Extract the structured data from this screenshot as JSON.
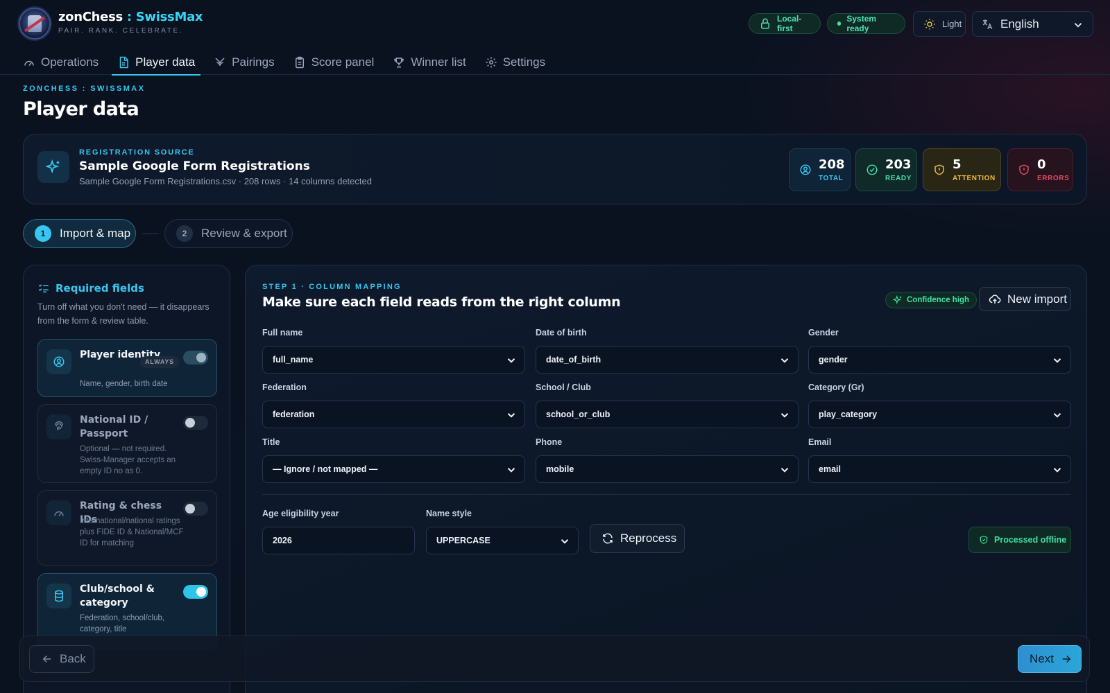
{
  "app": {
    "name": "zonChess",
    "separator": " : ",
    "product": "SwissMax",
    "tagline": "PAIR. RANK. CELEBRATE."
  },
  "header": {
    "local_first": "Local-first",
    "system_ready": "System ready",
    "theme_label": "Light",
    "language": "English"
  },
  "nav": {
    "tabs": [
      {
        "label": "Operations",
        "icon": "gauge-icon",
        "active": false
      },
      {
        "label": "Player data",
        "icon": "document-icon",
        "active": true
      },
      {
        "label": "Pairings",
        "icon": "swords-icon",
        "active": false
      },
      {
        "label": "Score panel",
        "icon": "clipboard-icon",
        "active": false
      },
      {
        "label": "Winner list",
        "icon": "trophy-icon",
        "active": false
      },
      {
        "label": "Settings",
        "icon": "gear-icon",
        "active": false
      }
    ]
  },
  "page": {
    "eyebrow": "ZONCHESS : SWISSMAX",
    "title": "Player data"
  },
  "source": {
    "eyebrow": "REGISTRATION SOURCE",
    "title": "Sample Google Form Registrations",
    "subtitle": "Sample Google Form Registrations.csv · 208 rows · 14 columns detected",
    "stats": {
      "total": {
        "value": "208",
        "label": "TOTAL"
      },
      "ready": {
        "value": "203",
        "label": "READY"
      },
      "attention": {
        "value": "5",
        "label": "ATTENTION"
      },
      "errors": {
        "value": "0",
        "label": "ERRORS"
      }
    }
  },
  "steps": [
    {
      "num": "1",
      "label": "Import & map",
      "active": true
    },
    {
      "num": "2",
      "label": "Review & export",
      "active": false
    }
  ],
  "required_fields": {
    "title": "Required fields",
    "description": "Turn off what you don't need — it disappears from the form & review table.",
    "groups": [
      {
        "title": "Player identity",
        "badge": "ALWAYS",
        "desc": "Name, gender, birth date",
        "enabled": true,
        "locked": true,
        "icon": "user-circle-icon"
      },
      {
        "title": "National ID / Passport",
        "desc": "Optional — not required. Swiss-Manager accepts an empty ID no as 0.",
        "enabled": false,
        "icon": "fingerprint-icon"
      },
      {
        "title": "Rating & chess IDs",
        "desc": "International/national ratings plus FIDE ID & National/MCF ID for matching",
        "enabled": false,
        "icon": "gauge-icon"
      },
      {
        "title": "Club/school & category",
        "desc": "Federation, school/club, category, title",
        "enabled": true,
        "icon": "database-icon"
      }
    ]
  },
  "mapping": {
    "eyebrow": "STEP 1 · COLUMN MAPPING",
    "title": "Make sure each field reads from the right column",
    "confidence": "Confidence high",
    "new_import": "New import",
    "fields": [
      {
        "label": "Full name",
        "value": "full_name"
      },
      {
        "label": "Date of birth",
        "value": "date_of_birth"
      },
      {
        "label": "Gender",
        "value": "gender"
      },
      {
        "label": "Federation",
        "value": "federation"
      },
      {
        "label": "School / Club",
        "value": "school_or_club"
      },
      {
        "label": "Category (Gr)",
        "value": "play_category"
      },
      {
        "label": "Title",
        "value": "— Ignore / not mapped —"
      },
      {
        "label": "Phone",
        "value": "mobile"
      },
      {
        "label": "Email",
        "value": "email"
      }
    ],
    "age_year": {
      "label": "Age eligibility year",
      "value": "2026"
    },
    "name_style": {
      "label": "Name style",
      "value": "UPPERCASE"
    },
    "reprocess": "Reprocess",
    "processed": "Processed offline"
  },
  "footer": {
    "back": "Back",
    "next": "Next"
  },
  "colors": {
    "accent": "#38c6f0",
    "success": "#3ee0a3",
    "warning": "#f1b93c",
    "danger": "#e24a63",
    "background": "#0a1220"
  }
}
